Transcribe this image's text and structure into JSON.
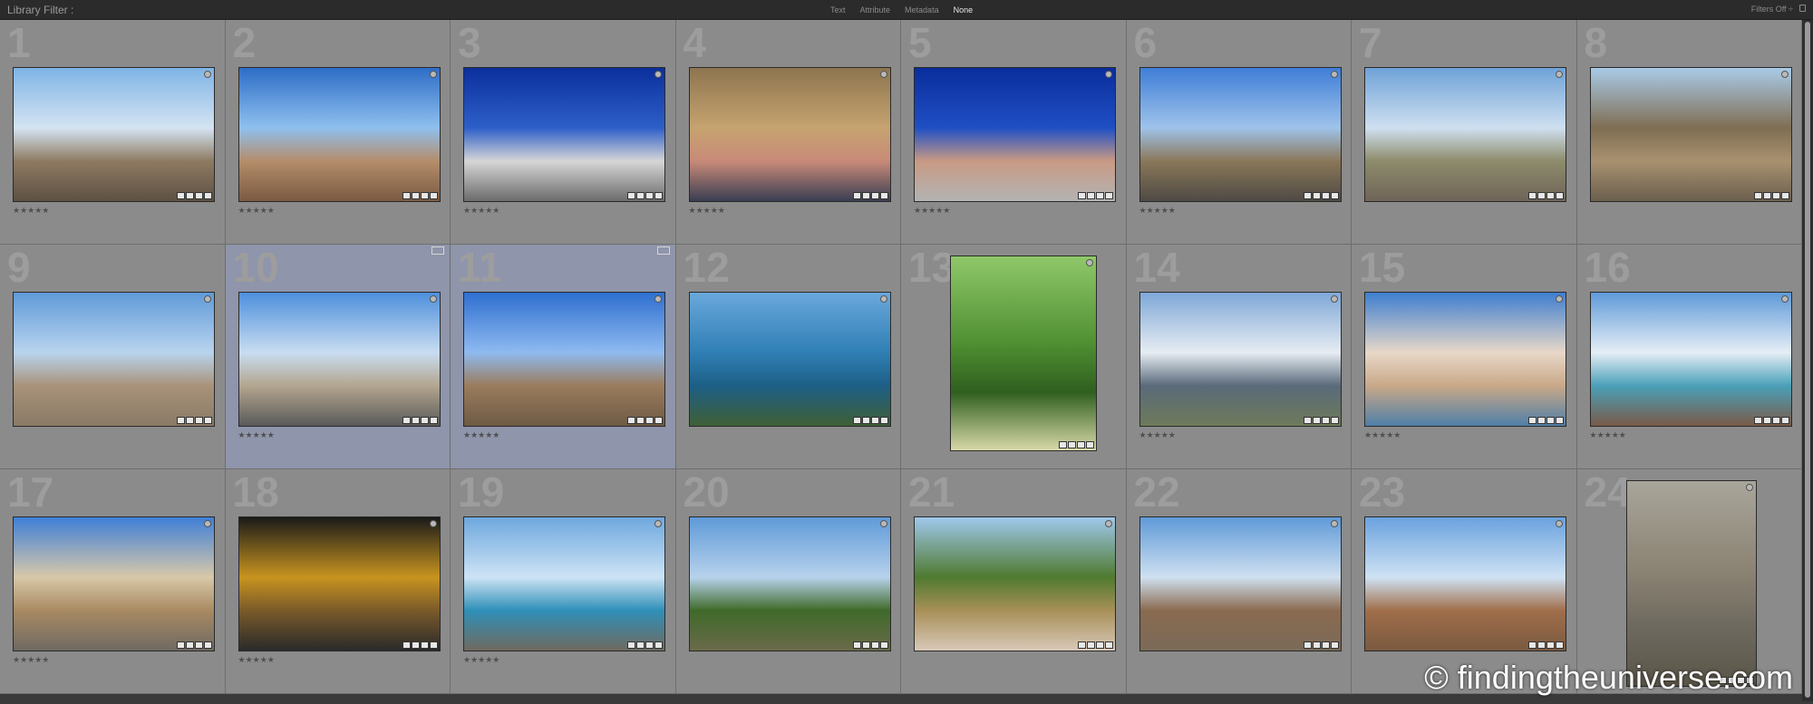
{
  "header": {
    "title": "Library Filter :",
    "filters": [
      "Text",
      "Attribute",
      "Metadata",
      "None"
    ],
    "active_filter": "None",
    "filters_state": "Filters Off ÷"
  },
  "grid": {
    "cells": [
      {
        "num": "1",
        "stars": "★★★★★",
        "orient": "land",
        "colors": [
          "#7fb4e6",
          "#d4e4f2",
          "#8e7a62",
          "#5d5043"
        ],
        "selected": false
      },
      {
        "num": "2",
        "stars": "★★★★★",
        "orient": "land",
        "colors": [
          "#2d6dc7",
          "#8fc0ee",
          "#b48d6a",
          "#7a5a42"
        ],
        "selected": false
      },
      {
        "num": "3",
        "stars": "★★★★★",
        "orient": "land",
        "colors": [
          "#0b2f9c",
          "#2d5fc8",
          "#d6d6d6",
          "#6b6b6b"
        ],
        "selected": false
      },
      {
        "num": "4",
        "stars": "★★★★★",
        "orient": "land",
        "colors": [
          "#8d7550",
          "#c6a36f",
          "#c88a78",
          "#3a3e52"
        ],
        "selected": false
      },
      {
        "num": "5",
        "stars": "★★★★★",
        "orient": "land",
        "colors": [
          "#0a2d9c",
          "#1f4fc4",
          "#c99a84",
          "#b3b3b3"
        ],
        "selected": false
      },
      {
        "num": "6",
        "stars": "★★★★★",
        "orient": "land",
        "colors": [
          "#3f7ed8",
          "#9fc3ea",
          "#8a7758",
          "#4e4a45"
        ],
        "selected": false
      },
      {
        "num": "7",
        "stars": "",
        "orient": "land",
        "colors": [
          "#6ea2d8",
          "#cfe0f0",
          "#8d8b6b",
          "#6f6458"
        ],
        "selected": false
      },
      {
        "num": "8",
        "stars": "",
        "orient": "land",
        "colors": [
          "#a9cbe8",
          "#7f6e53",
          "#a8916f",
          "#6b5f4e"
        ],
        "selected": false
      },
      {
        "num": "9",
        "stars": "",
        "orient": "land",
        "colors": [
          "#5f9ad8",
          "#b9d4ee",
          "#a89279",
          "#8a7a66"
        ],
        "selected": false
      },
      {
        "num": "10",
        "stars": "★★★★★",
        "orient": "land",
        "colors": [
          "#4d8fdc",
          "#c9ddf1",
          "#b3a58f",
          "#5a5a5a"
        ],
        "selected": true
      },
      {
        "num": "11",
        "stars": "★★★★★",
        "orient": "land",
        "colors": [
          "#2e6fd0",
          "#8fbaf0",
          "#9a7c5c",
          "#6e5a45"
        ],
        "selected": true
      },
      {
        "num": "12",
        "stars": "",
        "orient": "land",
        "colors": [
          "#6aa8dc",
          "#2f7fb5",
          "#1d5f86",
          "#3f5f35"
        ],
        "selected": false
      },
      {
        "num": "13",
        "stars": "",
        "orient": "port",
        "colors": [
          "#8fc86a",
          "#4f8f32",
          "#2f5f1f",
          "#d8d8a8"
        ],
        "selected": false
      },
      {
        "num": "14",
        "stars": "★★★★★",
        "orient": "land",
        "colors": [
          "#7fa8d8",
          "#e6ecf2",
          "#5a6a7a",
          "#6e7a5a"
        ],
        "selected": false
      },
      {
        "num": "15",
        "stars": "★★★★★",
        "orient": "land",
        "colors": [
          "#3e7ed0",
          "#e8d8c8",
          "#c8a888",
          "#4f7fa8"
        ],
        "selected": false
      },
      {
        "num": "16",
        "stars": "★★★★★",
        "orient": "land",
        "colors": [
          "#5f9ad8",
          "#e6eef6",
          "#4aa0b8",
          "#7a5a48"
        ],
        "selected": false
      },
      {
        "num": "17",
        "stars": "★★★★★",
        "orient": "land",
        "colors": [
          "#3f7fd8",
          "#d8c8a8",
          "#a88a62",
          "#6f6a62"
        ],
        "selected": false
      },
      {
        "num": "18",
        "stars": "★★★★★",
        "orient": "land",
        "colors": [
          "#1a1a1a",
          "#c8941f",
          "#7a5a2a",
          "#2a2a2a"
        ],
        "selected": false
      },
      {
        "num": "19",
        "stars": "★★★★★",
        "orient": "land",
        "colors": [
          "#6ea8de",
          "#cde3f5",
          "#2f8fb8",
          "#6f6a5f"
        ],
        "selected": false
      },
      {
        "num": "20",
        "stars": "",
        "orient": "land",
        "colors": [
          "#5f9ad8",
          "#b7d2ec",
          "#3f6a2a",
          "#6a6a4a"
        ],
        "selected": false
      },
      {
        "num": "21",
        "stars": "",
        "orient": "land",
        "colors": [
          "#9fc8ec",
          "#4f7a2f",
          "#a89058",
          "#d8c8b8"
        ],
        "selected": false
      },
      {
        "num": "22",
        "stars": "",
        "orient": "land",
        "colors": [
          "#5f9ad8",
          "#cfe0f0",
          "#8a6a4f",
          "#7a6a58"
        ],
        "selected": false
      },
      {
        "num": "23",
        "stars": "",
        "orient": "land",
        "colors": [
          "#6aa2de",
          "#cfe2f4",
          "#a06e4a",
          "#7a5a40"
        ],
        "selected": false
      },
      {
        "num": "24",
        "stars": "",
        "orient": "port-full",
        "colors": [
          "#a8a59a",
          "#8a8272",
          "#6f6a60",
          "#5a5548"
        ],
        "selected": false
      }
    ]
  },
  "watermark": "© findingtheuniverse.com"
}
